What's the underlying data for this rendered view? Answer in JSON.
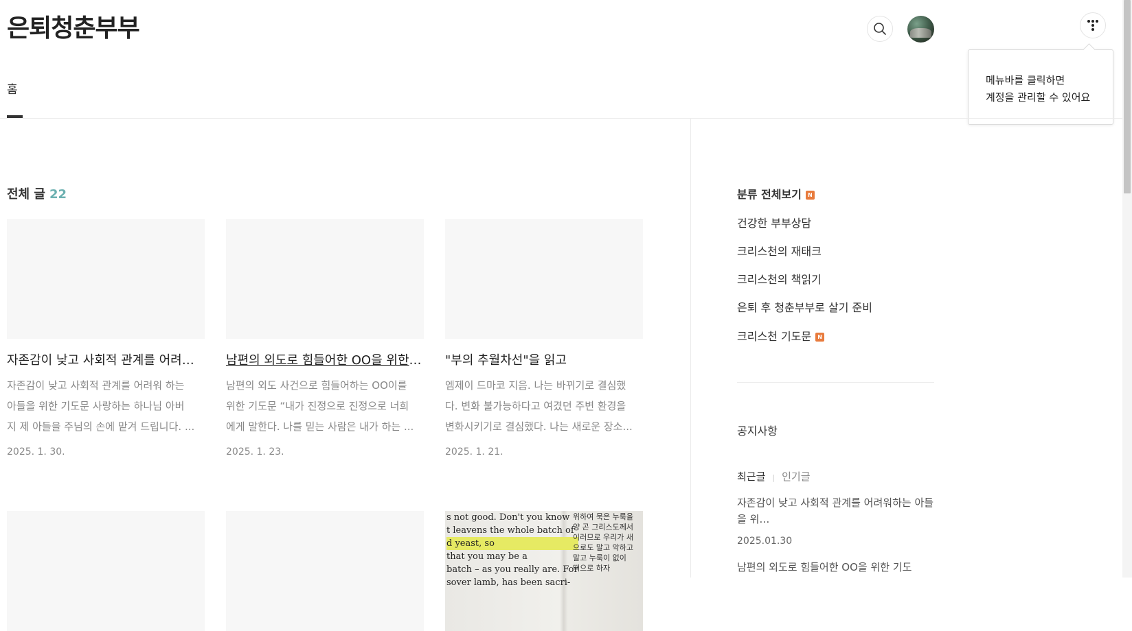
{
  "header": {
    "site_title": "은퇴청춘부부",
    "search_icon": "search-icon",
    "menu_icon": "dots-menu-icon",
    "tooltip": {
      "line1": "메뉴바를 클릭하면",
      "line2": "계정을 관리할 수 있어요"
    }
  },
  "nav": {
    "tabs": [
      {
        "label": "홈",
        "active": true
      }
    ]
  },
  "main": {
    "heading": "전체 글",
    "count": "22",
    "posts": [
      {
        "title": "자존감이 낮고 사회적 관계를 어려워하는 아들을 위한 기도문",
        "excerpt": [
          "자존감이 낮고 사회적 관계를 어려워 하는",
          "아들을 위한 기도문 사랑하는 하나님 아버",
          "지 제 아들을 주님의 손에 맡겨 드립니다. ..."
        ],
        "date": "2025. 1. 30."
      },
      {
        "title": "남편의 외도로 힘들어한 OO을 위한 기도문",
        "excerpt": [
          "남편의 외도 사건으로 힘들어하는 OO이를",
          "위한 기도문 “내가 진정으로 진정으로 너희",
          "에게 말한다. 나를 믿는 사람은 내가 하는 ..."
        ],
        "date": "2025. 1. 23."
      },
      {
        "title": "\"부의 추월차선\"을 읽고",
        "excerpt": [
          "엠제이 드마코 지음. 나는 바뀌기로 결심했",
          "다. 변화 불가능하다고 여겼던 주변 환경을",
          "변화시키기로 결심했다. 나는 새로운 장소..."
        ],
        "date": "2025. 1. 21."
      }
    ],
    "book_text": {
      "eng": [
        "s not good. Don't you know",
        "t leavens the whole batch of",
        "d yeast, so that you may be a",
        "batch – as you really are. For",
        "sover lamb, has been sacri-"
      ],
      "highlight": "d yeast, so",
      "highlight_rest": " that you may be a",
      "kor": [
        "위하여 묵은 누룩을",
        "양 곤 그리스도께서",
        "이러므로 우리가 새",
        "으로도 말고 악하고",
        "말고 누룩이 없이",
        "떡으로 하자"
      ]
    }
  },
  "sidebar": {
    "categories": [
      {
        "label": "분류 전체보기",
        "badge": "N",
        "strong": true
      },
      {
        "label": "건강한 부부상담"
      },
      {
        "label": "크리스천의 재태크"
      },
      {
        "label": "크리스천의 책읽기"
      },
      {
        "label": "은퇴 후 청춘부부로 살기 준비"
      },
      {
        "label": "크리스천 기도문",
        "badge": "N"
      }
    ],
    "notice_heading": "공지사항",
    "tabs": {
      "recent": "최근글",
      "popular": "인기글"
    },
    "recent_posts": [
      {
        "title": "자존감이 낮고 사회적 관계를 어려워하는 아들을 위…",
        "date": "2025.01.30"
      },
      {
        "title": "남편의 외도로 힘들어한 OO을 위한 기도"
      }
    ]
  },
  "colors": {
    "count_accent": "#6bb0b0",
    "badge": "#e87b3d"
  }
}
